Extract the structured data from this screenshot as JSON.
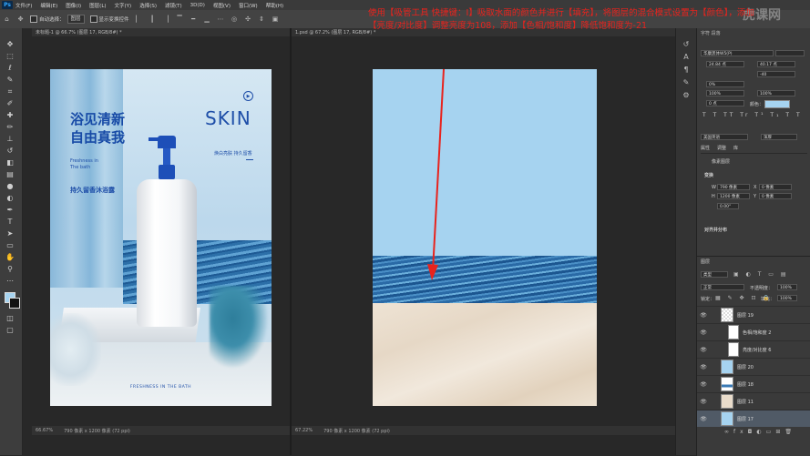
{
  "app": {
    "logo_text": "Ps"
  },
  "menu": [
    "文件(F)",
    "编辑(E)",
    "图像(I)",
    "图层(L)",
    "文字(Y)",
    "选择(S)",
    "滤镜(T)",
    "3D(D)",
    "视图(V)",
    "窗口(W)",
    "帮助(H)"
  ],
  "options": {
    "auto_select_label": "自动选择：",
    "auto_select_value": "图层",
    "show_transform_label": "显示变换控件",
    "workspace": "基本功能"
  },
  "tutorial_overlay": {
    "text": "使用【吸管工具 快捷键：I】吸取水面的颜色并进行【填充】，将图层的混合模式设置为【颜色】，添加【亮度/对比度】调整亮度为108，添加【色相/饱和度】降低饱和度为-21",
    "color": "#e8231d"
  },
  "watermark": {
    "text": "虎课网"
  },
  "doc_left": {
    "tab": "未标题-1 @ 66.7% (图层 17, RGB/8#) *",
    "zoom": "66.67%",
    "status": "790 像素 x 1200 像素 (72 ppi)",
    "poster": {
      "title_line1": "浴见清新",
      "title_line2": "自由真我",
      "en_line1": "Freshness in",
      "en_line2": "The bath",
      "product_cn": "持久留香沐浴露",
      "skin": "SKIN",
      "slogan_small": "焕白亮肤 持久留香",
      "footer": "FRESHNESS IN THE BATH"
    }
  },
  "doc_right": {
    "tab": "1.psd @ 67.2% (图层 17, RGB/8#) *",
    "zoom": "67.22%",
    "status": "790 像素 x 1200 像素 (72 ppi)"
  },
  "char_panel": {
    "font_family": "华康黑体W5(P)",
    "font_size": "24.84 点",
    "leading": "40.17 点",
    "tracking": "-40",
    "kerning_pct": "0%",
    "vscale": "100%",
    "hscale": "100%",
    "baseline": "0 点",
    "color_label": "颜色：",
    "color": "#a6d3f0",
    "lang": "美国英语",
    "antialias": "浑厚"
  },
  "properties_panel": {
    "tabs": [
      "属性",
      "调整",
      "库"
    ],
    "pixel_layer": "像素图层",
    "transform_title": "变换",
    "w_value": "790 像素",
    "x_value": "0 像素",
    "h_value": "1200 像素",
    "y_value": "0 像素",
    "angle": "0.00°",
    "align_title": "对齐并分布"
  },
  "layers_panel": {
    "tab": "图层",
    "kind_label": "类型",
    "blend_mode": "正常",
    "opacity_label": "不透明度：",
    "opacity_value": "100%",
    "lock_label": "锁定：",
    "fill_label": "填充：",
    "fill_value": "100%",
    "layers": [
      {
        "name": "图层 19"
      },
      {
        "name": "色相/饱和度 2"
      },
      {
        "name": "亮度/对比度 6"
      },
      {
        "name": "图层 20"
      },
      {
        "name": "图层 18"
      },
      {
        "name": "图层 11"
      },
      {
        "name": "图层 17"
      }
    ]
  },
  "fg_color": "#a6d3f0",
  "bg_color": "#111111"
}
